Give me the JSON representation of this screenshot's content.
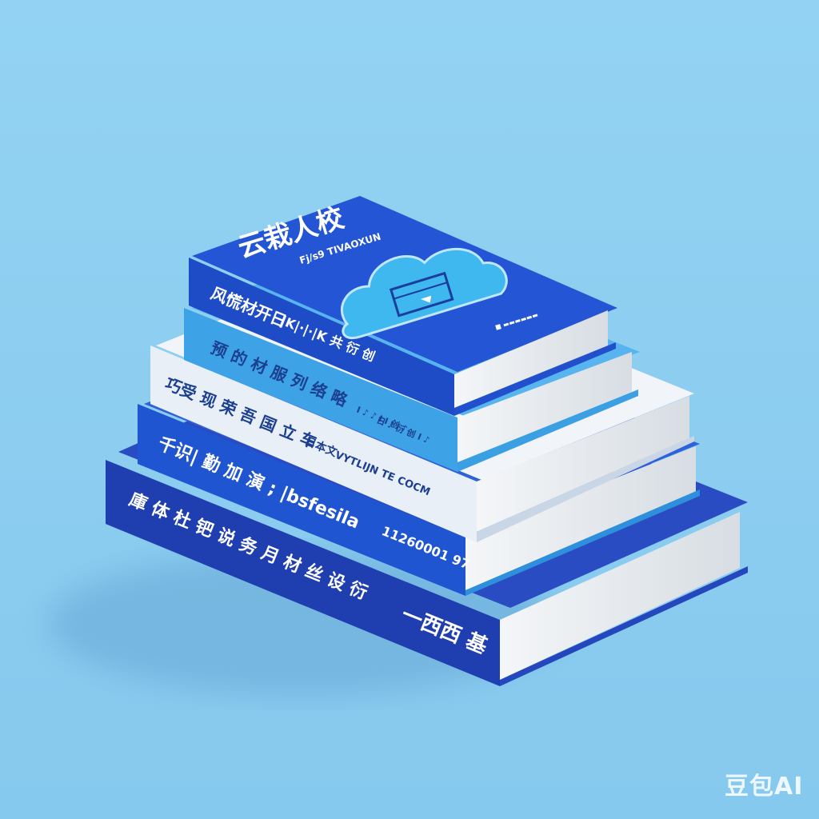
{
  "scene": {
    "background_color": "#8ecff0",
    "description_colors": {
      "deep_blue": "#1f3fb8",
      "royal_blue": "#1d4fd0",
      "sky_blue": "#3e9ee6",
      "white": "#eef3fa"
    }
  },
  "books": {
    "top": {
      "cover_title": "云栽人校",
      "cover_subtitle": "Fj/s9 TIVAOXUN",
      "cover_icon": "cloud-icon",
      "cover_small": "■ ▬▬▬▬▬▬",
      "spine_text_left": "风慌材开日",
      "spine_text_right": "|K|·|·|K 共 衍 创 "
    },
    "second": {
      "spine_text_left": "预 的 材 服 列 络 略 ",
      "spine_text_right": "日 ♪ 衍 创 Ⅰ ♪"
    },
    "third": {
      "spine_text_left": "巧受 现 荣 吾 国 立 车",
      "spine_text_right": "Ⅰ ♪ ♪ Ⅰ Ⅰ 创 ♪"
    },
    "fourth": {
      "spine_text_left": "千识| 勤 加 演 ; |bsfesila",
      "spine_text_mid": "日本文",
      "spine_text_right": "VYTLIJN TE COCM",
      "spine_code": "11260001 97"
    },
    "bottom": {
      "spine_text_left": "庫 体 杜 钯 说 务 月 材 丝 设 衍",
      "spine_text_right": "一西西 基"
    }
  },
  "watermark": "豆包AI"
}
